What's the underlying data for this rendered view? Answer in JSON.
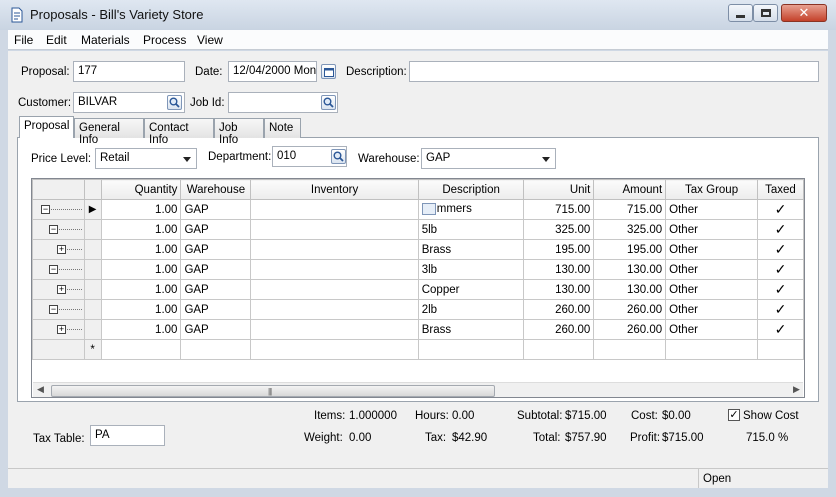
{
  "window": {
    "title": "Proposals - Bill's Variety Store"
  },
  "menu": [
    "File",
    "Edit",
    "Materials",
    "Process",
    "View"
  ],
  "form": {
    "proposal_label": "Proposal:",
    "proposal_value": "177",
    "date_label": "Date:",
    "date_value": "12/04/2000 Mon",
    "description_label": "Description:",
    "description_value": "",
    "customer_label": "Customer:",
    "customer_value": "BILVAR",
    "jobid_label": "Job Id:",
    "jobid_value": ""
  },
  "tabs": [
    "Proposal",
    "General Info",
    "Contact Info",
    "Job Info",
    "Note"
  ],
  "filters": {
    "price_level_label": "Price Level:",
    "price_level_value": "Retail",
    "department_label": "Department:",
    "department_value": "010",
    "warehouse_label": "Warehouse:",
    "warehouse_value": "GAP"
  },
  "grid": {
    "columns": [
      "Quantity",
      "Warehouse",
      "Inventory",
      "Description",
      "Unit",
      "Amount",
      "Tax Group",
      "Taxed"
    ],
    "rows": [
      {
        "tree": "root-minus",
        "quantity": "1.00",
        "warehouse": "GAP",
        "inventory": "",
        "description": "mmers",
        "unit": "715.00",
        "amount": "715.00",
        "taxgroup": "Other",
        "taxed": "✓"
      },
      {
        "tree": "child-minus",
        "quantity": "1.00",
        "warehouse": "GAP",
        "inventory": "",
        "description": "5lb",
        "unit": "325.00",
        "amount": "325.00",
        "taxgroup": "Other",
        "taxed": "✓"
      },
      {
        "tree": "grandchild-plus",
        "quantity": "1.00",
        "warehouse": "GAP",
        "inventory": "",
        "description": "Brass",
        "unit": "195.00",
        "amount": "195.00",
        "taxgroup": "Other",
        "taxed": "✓"
      },
      {
        "tree": "child-minus",
        "quantity": "1.00",
        "warehouse": "GAP",
        "inventory": "",
        "description": "3lb",
        "unit": "130.00",
        "amount": "130.00",
        "taxgroup": "Other",
        "taxed": "✓"
      },
      {
        "tree": "grandchild-plus",
        "quantity": "1.00",
        "warehouse": "GAP",
        "inventory": "",
        "description": "Copper",
        "unit": "130.00",
        "amount": "130.00",
        "taxgroup": "Other",
        "taxed": "✓"
      },
      {
        "tree": "child-minus",
        "quantity": "1.00",
        "warehouse": "GAP",
        "inventory": "",
        "description": "2lb",
        "unit": "260.00",
        "amount": "260.00",
        "taxgroup": "Other",
        "taxed": "✓"
      },
      {
        "tree": "grandchild-plus",
        "quantity": "1.00",
        "warehouse": "GAP",
        "inventory": "",
        "description": "Brass",
        "unit": "260.00",
        "amount": "260.00",
        "taxgroup": "Other",
        "taxed": "✓"
      }
    ],
    "new_row_marker": "*"
  },
  "totals": {
    "items_label": "Items:",
    "items_value": "1.000000",
    "hours_label": "Hours:",
    "hours_value": "0.00",
    "subtotal_label": "Subtotal:",
    "subtotal_value": "$715.00",
    "cost_label": "Cost:",
    "cost_value": "$0.00",
    "show_cost_label": "Show Cost",
    "weight_label": "Weight:",
    "weight_value": "0.00",
    "tax_label": "Tax:",
    "tax_value": "$42.90",
    "total_label": "Total:",
    "total_value": "$757.90",
    "profit_label": "Profit:",
    "profit_value": "$715.00",
    "profit_pct": "715.0 %",
    "taxtable_label": "Tax Table:",
    "taxtable_value": "PA"
  },
  "status": {
    "text": "Open"
  },
  "icons": {
    "app": "document-icon",
    "lookup": "magnifier-icon",
    "calendar": "calendar-icon"
  }
}
